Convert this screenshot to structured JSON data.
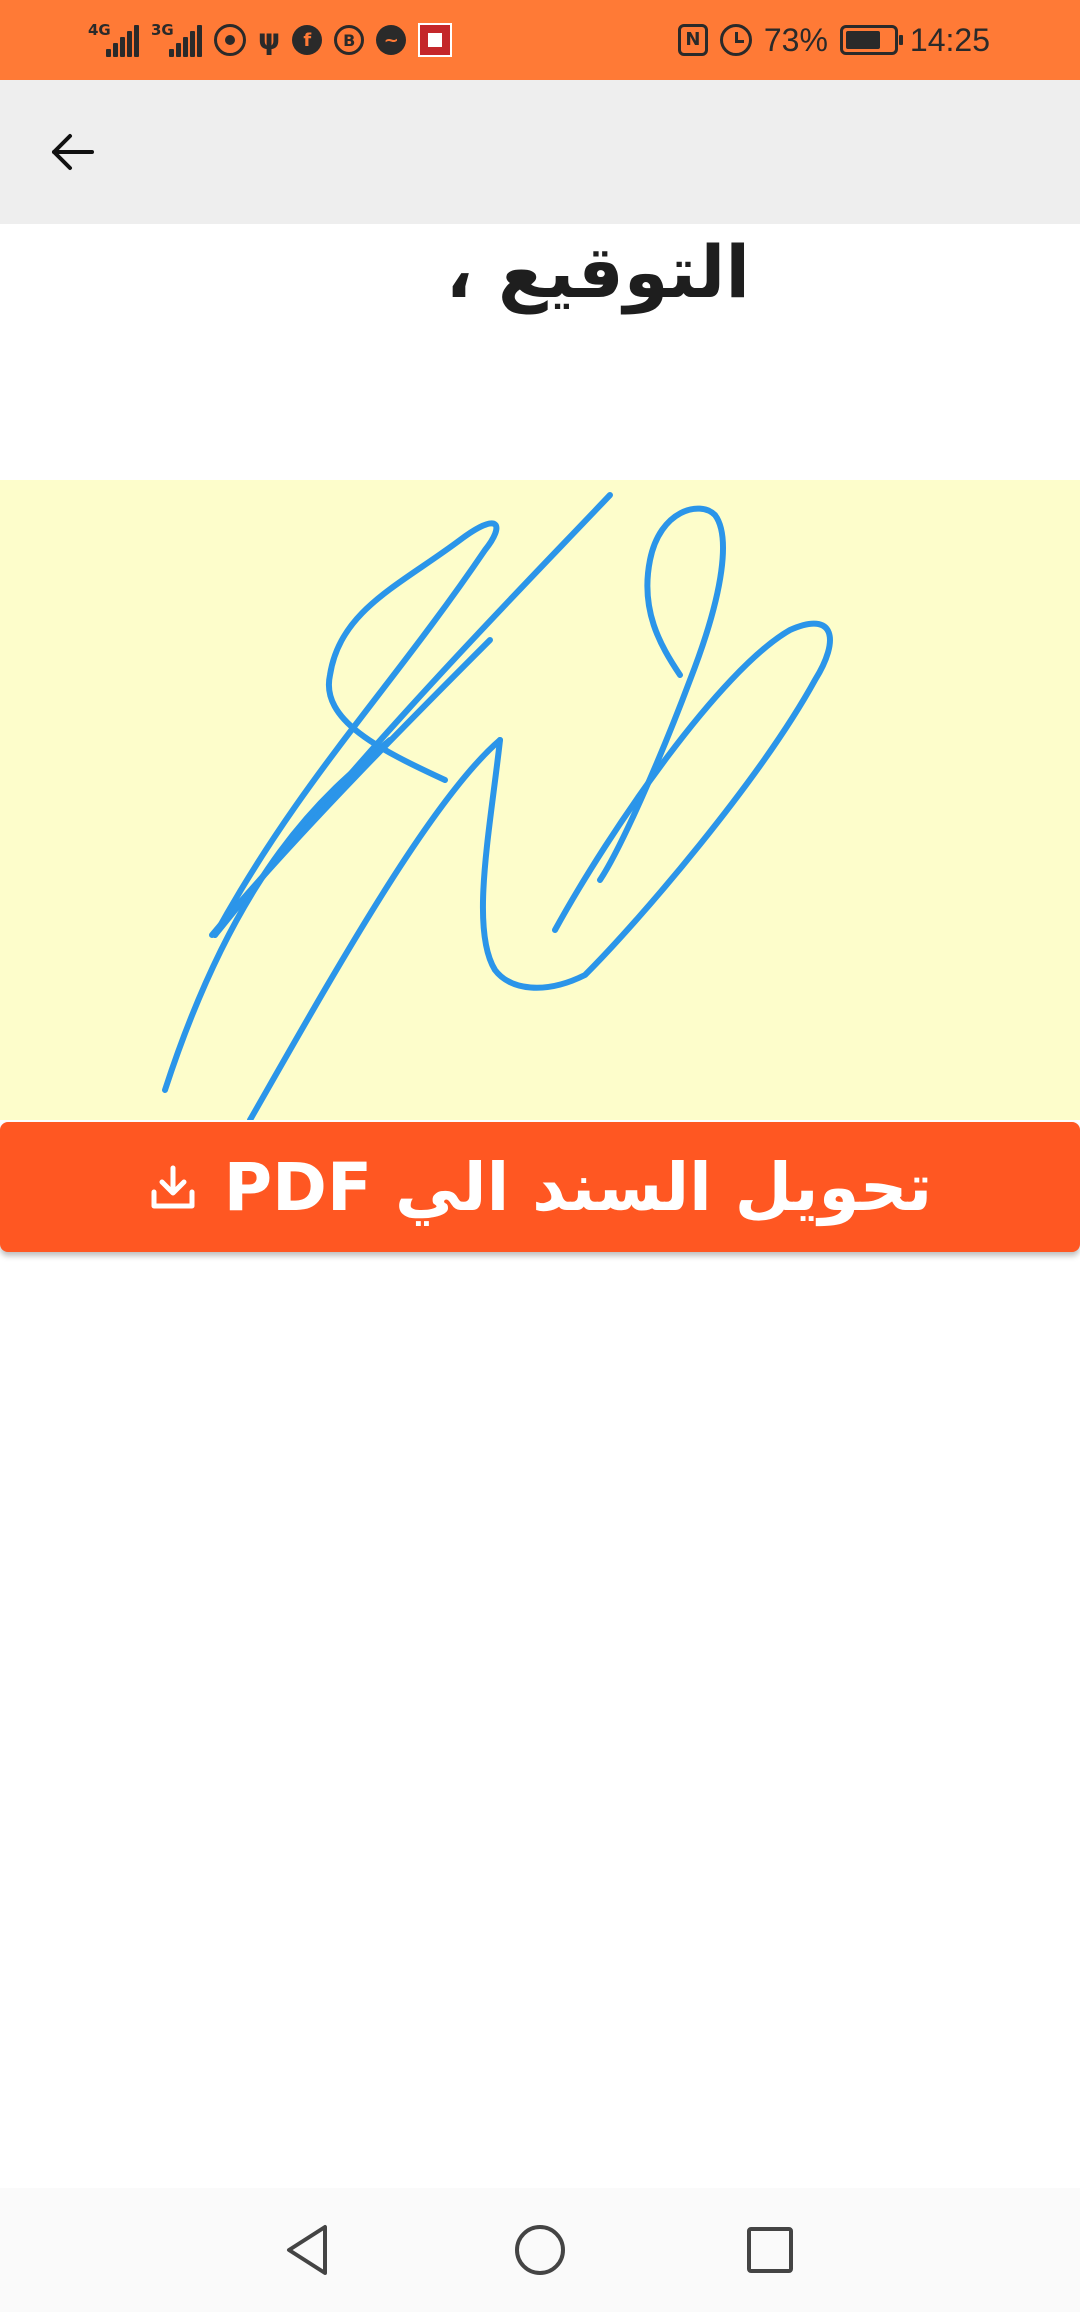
{
  "status_bar": {
    "network_1": "4G",
    "network_2": "3G",
    "battery_percent": "73%",
    "battery_level": 0.73,
    "time": "14:25",
    "icons": [
      "hotspot-icon",
      "usb-icon",
      "facebook-icon",
      "b-icon",
      "messenger-icon",
      "office-icon",
      "nfc-icon",
      "alarm-icon",
      "battery-icon"
    ]
  },
  "app_bar": {
    "back_icon": "arrow-left-icon"
  },
  "page": {
    "title": "التوقيع ،"
  },
  "signature_pad": {
    "background": "#fdfdcb",
    "stroke_color": "#2b95e9"
  },
  "convert_button": {
    "label": "تحويل السند الي PDF",
    "icon": "download-icon",
    "color": "#ff5722"
  },
  "nav_bar": {
    "back": "triangle-back-icon",
    "home": "circle-home-icon",
    "recents": "square-recents-icon"
  },
  "colors": {
    "status_bar": "#ff7a36",
    "app_bar": "#eeeeee"
  }
}
